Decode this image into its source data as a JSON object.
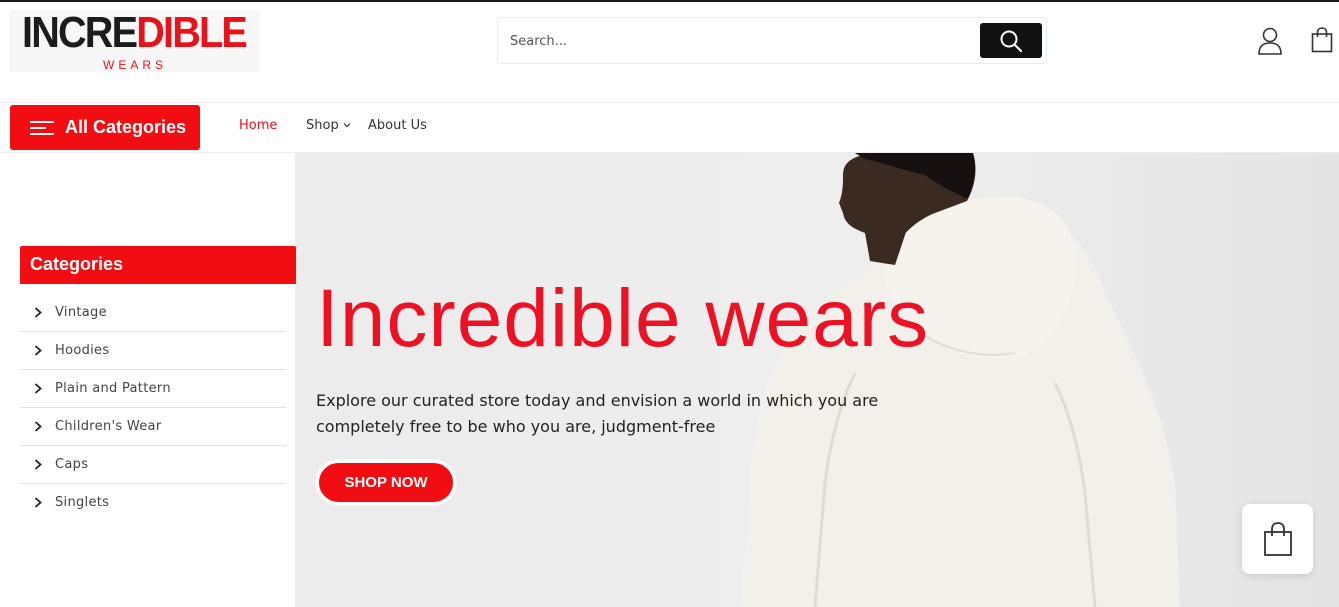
{
  "brand": {
    "logo_part1": "INCRE",
    "logo_part2": "DIBLE",
    "logo_sub": "WEARS",
    "accent_color": "#f20d12"
  },
  "search": {
    "placeholder": "Search...",
    "button_icon": "search-icon"
  },
  "header_icons": [
    "user-icon",
    "shopping-bag-icon"
  ],
  "nav": {
    "all_categories_label": "All Categories",
    "home": "Home",
    "shop": "Shop",
    "about": "About Us"
  },
  "sidebar": {
    "title": "Categories",
    "items": [
      {
        "label": "Vintage"
      },
      {
        "label": "Hoodies"
      },
      {
        "label": "Plain and Pattern"
      },
      {
        "label": "Children's Wear"
      },
      {
        "label": "Caps"
      },
      {
        "label": "Singlets"
      }
    ]
  },
  "hero": {
    "title": "Incredible wears",
    "subtitle": "Explore our curated store today and envision a world in which you are completely free to be who you are, judgment-free",
    "cta": "SHOP NOW"
  }
}
